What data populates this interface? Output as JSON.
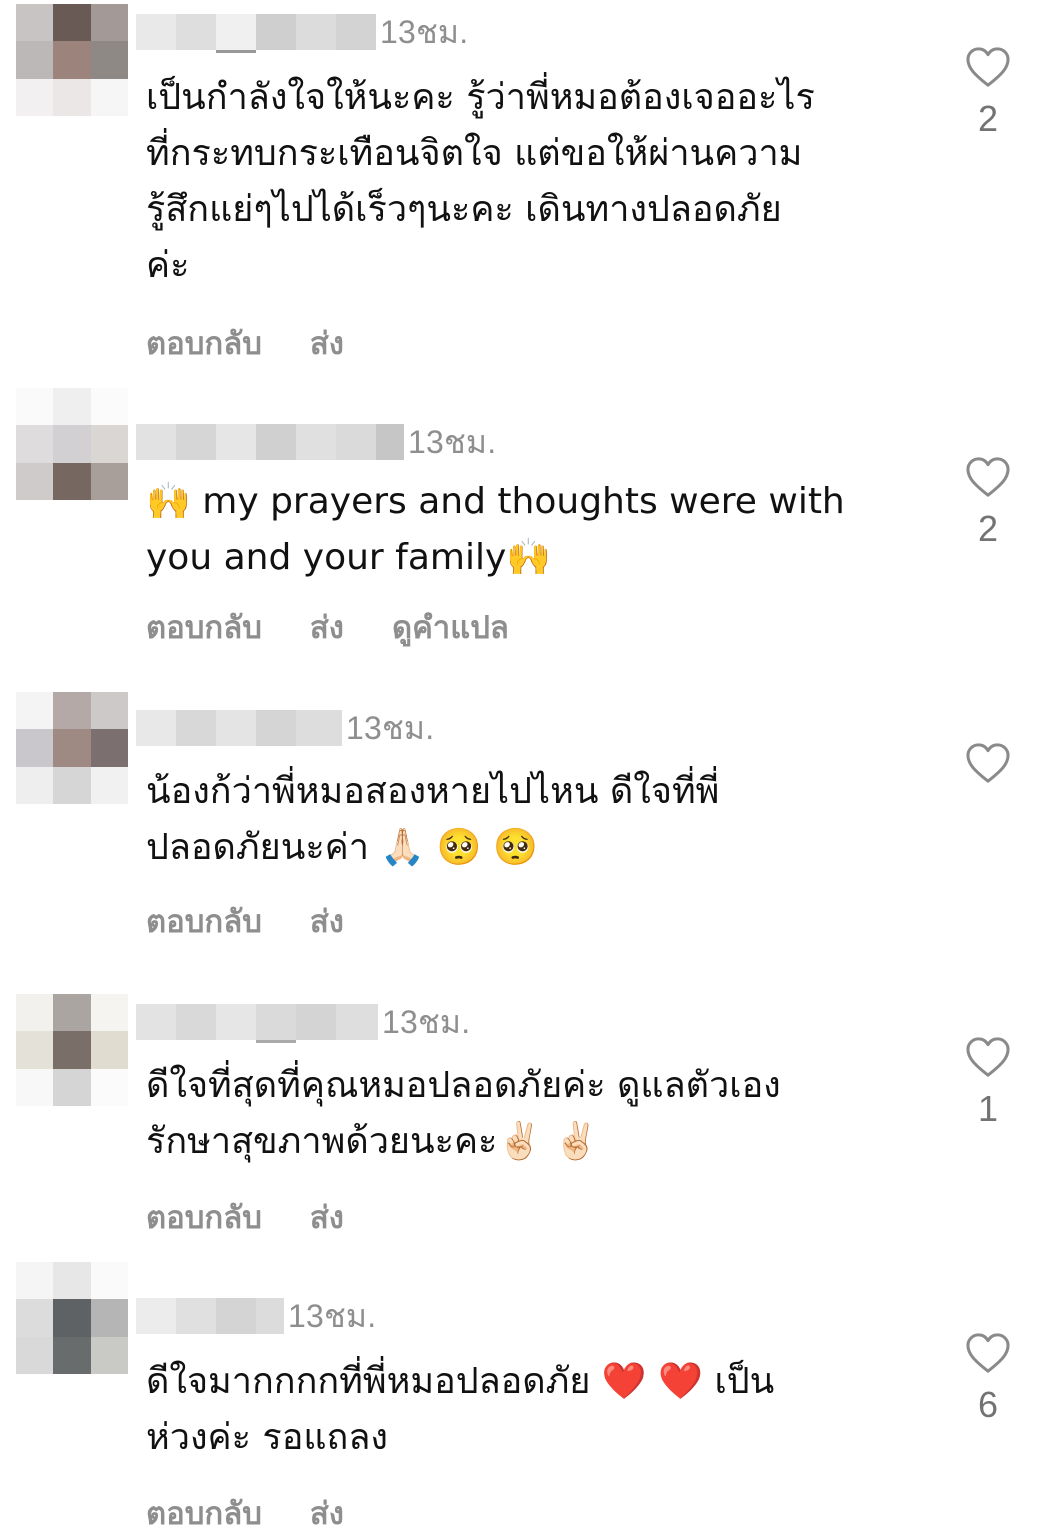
{
  "comments": [
    {
      "timestamp": "13ชม.",
      "lines": [
        "เป็นกำลังใจให้นะคะ รู้ว่าพี่หมอต้องเจออะไร",
        "ที่กระทบกระเทือนจิตใจ แต่ขอให้ผ่านความ",
        "รู้สึกแย่ๆไปได้เร็วๆนะคะ เดินทางปลอดภัย",
        "ค่ะ"
      ],
      "actions": [
        "ตอบกลับ",
        "ส่ง"
      ],
      "likes": "2"
    },
    {
      "timestamp": "13ชม.",
      "lines": [
        "🙌 my prayers and thoughts were with",
        "you and your family🙌"
      ],
      "actions": [
        "ตอบกลับ",
        "ส่ง",
        "ดูคำแปล"
      ],
      "likes": "2"
    },
    {
      "timestamp": "13ชม.",
      "lines": [
        "น้องก้ว่าพี่หมอสองหายไปไหน ดีใจที่พี่",
        "ปลอดภัยนะค่า 🙏🏻 🥺 🥺"
      ],
      "actions": [
        "ตอบกลับ",
        "ส่ง"
      ],
      "likes": ""
    },
    {
      "timestamp": "13ชม.",
      "lines": [
        "ดีใจที่สุดที่คุณหมอปลอดภัยค่ะ ดูแลตัวเอง",
        "รักษาสุขภาพด้วยนะคะ✌🏻 ✌🏻"
      ],
      "actions": [
        "ตอบกลับ",
        "ส่ง"
      ],
      "likes": "1"
    },
    {
      "timestamp": "13ชม.",
      "lines": [
        "ดีใจมากกกกที่พี่หมอปลอดภัย ❤️ ❤️ เป็น",
        "ห่วงค่ะ รอแถลง"
      ],
      "actions": [
        "ตอบกลับ",
        "ส่ง"
      ],
      "likes": "6"
    }
  ],
  "icons": {
    "like": "heart-outline-icon"
  },
  "colors": {
    "muted": "#8e8e8e",
    "text": "#111111",
    "background": "#ffffff"
  }
}
